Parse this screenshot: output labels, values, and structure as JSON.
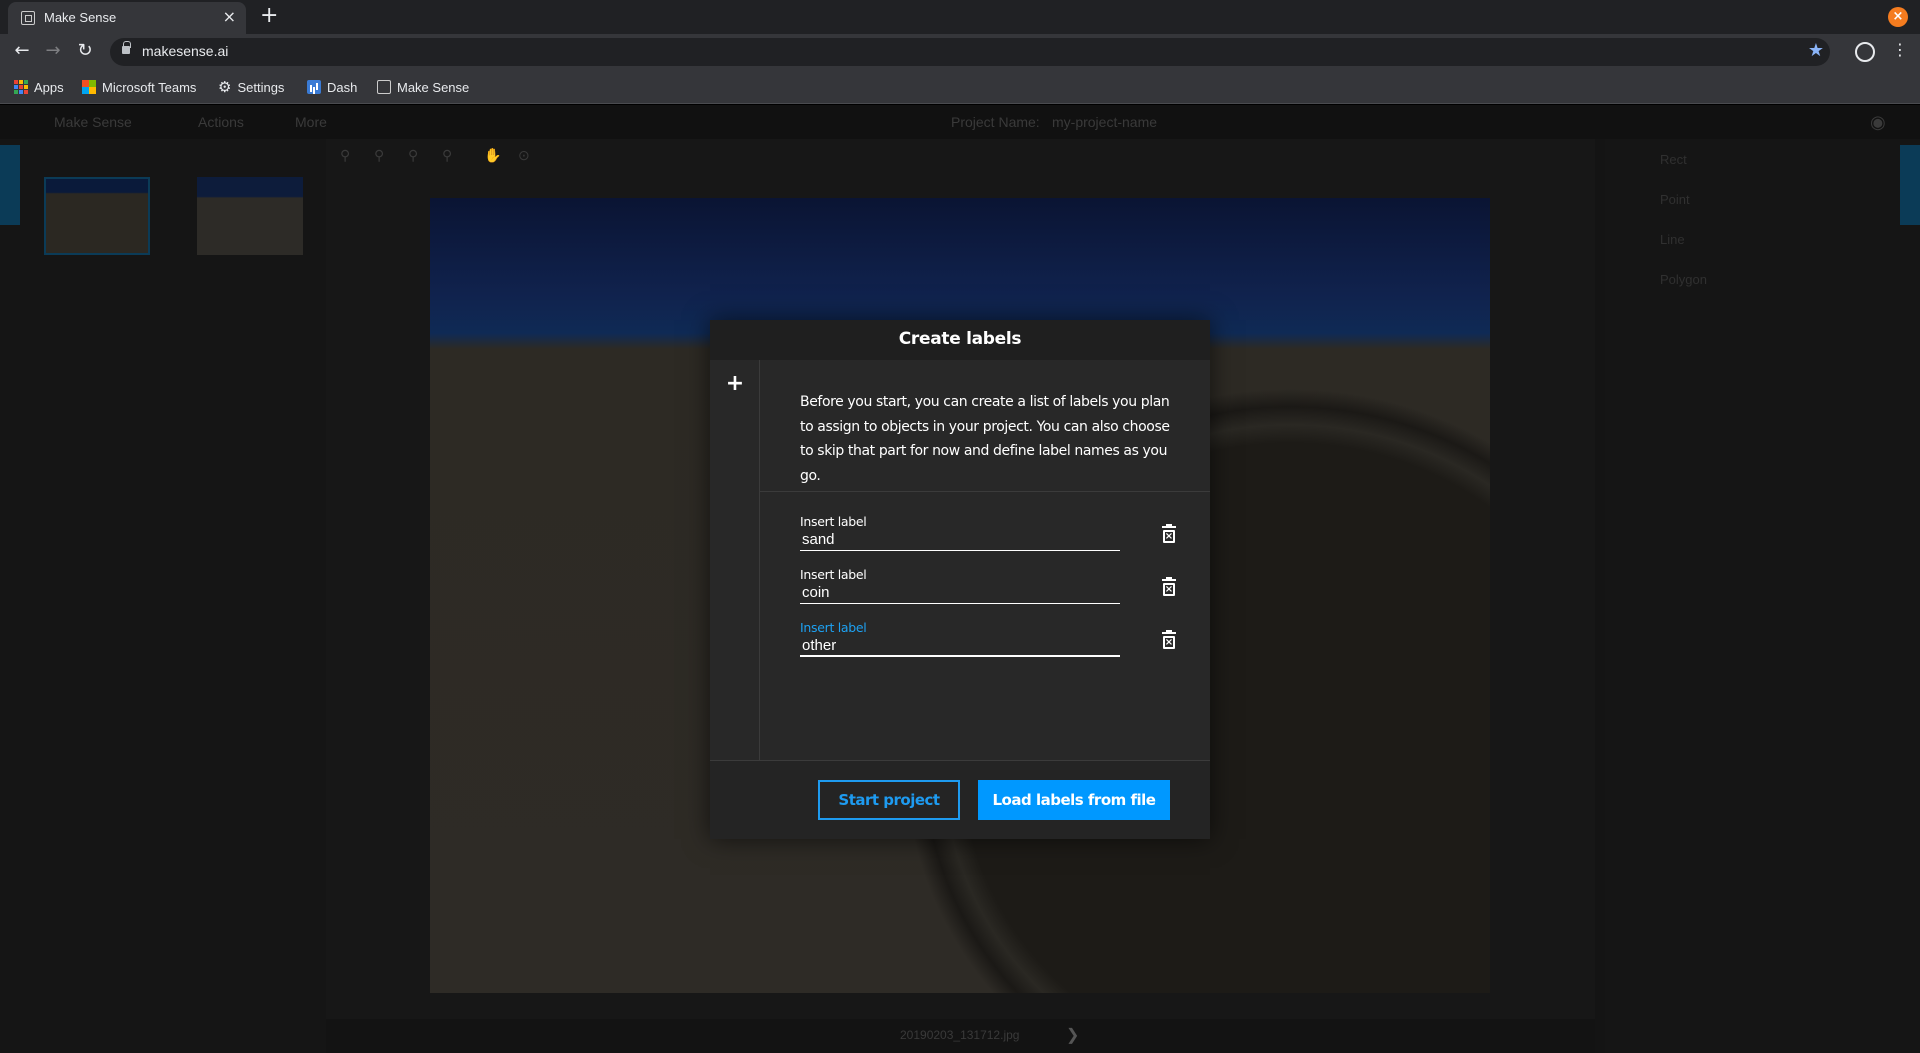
{
  "browser": {
    "tab_title": "Make Sense",
    "tab_close": "×",
    "new_tab": "+",
    "url": "makesense.ai",
    "bookmarks": [
      {
        "label": "Apps"
      },
      {
        "label": "Microsoft Teams"
      },
      {
        "label": "Settings"
      },
      {
        "label": "Dash"
      },
      {
        "label": "Make Sense"
      }
    ],
    "window_close": "×",
    "accent_color": "#f57c1f"
  },
  "app": {
    "brand": "Make Sense",
    "menu_actions": "Actions",
    "menu_more": "More",
    "project_label": "Project Name:",
    "project_name": "my-project-name",
    "right_tools": [
      "Rect",
      "Point",
      "Line",
      "Polygon"
    ],
    "image_filename": "20190203_131712.jpg"
  },
  "modal": {
    "title": "Create labels",
    "add_icon": "+",
    "description": "Before you start, you can create a list of labels you plan to assign to objects in your project. You can also choose to skip that part for now and define label names as you go.",
    "labels": [
      {
        "caption": "Insert label",
        "value": "sand"
      },
      {
        "caption": "Insert label",
        "value": "coin"
      },
      {
        "caption": "Insert label",
        "value": "other"
      }
    ],
    "start_button": "Start project",
    "load_button": "Load labels from file",
    "accent_color": "#0098ff"
  }
}
